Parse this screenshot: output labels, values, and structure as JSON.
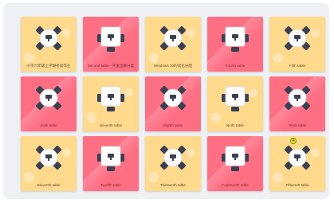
{
  "tables": [
    {
      "label": "小学六年级上学期考试作业",
      "color": "yellow",
      "style": "round"
    },
    {
      "label": "Second table - 开发出版分类",
      "color": "red",
      "style": "square"
    },
    {
      "label": "Windows 10的优化分配",
      "color": "yellow",
      "style": "round"
    },
    {
      "label": "Fourth table",
      "color": "red",
      "style": "square"
    },
    {
      "label": "Fifth table",
      "color": "yellow",
      "style": "round"
    },
    {
      "label": "Sixth table",
      "color": "red",
      "style": "round"
    },
    {
      "label": "Seventh table",
      "color": "yellow",
      "style": "square"
    },
    {
      "label": "Eighth table",
      "color": "red",
      "style": "round"
    },
    {
      "label": "Ninth table",
      "color": "yellow",
      "style": "square"
    },
    {
      "label": "Tenth table",
      "color": "red",
      "style": "round"
    },
    {
      "label": "Eleventh table",
      "color": "yellow",
      "style": "round"
    },
    {
      "label": "Twelfth table",
      "color": "red",
      "style": "square"
    },
    {
      "label": "Thirteenth table",
      "color": "yellow",
      "style": "round"
    },
    {
      "label": "Fourteenth table",
      "color": "red",
      "style": "square"
    },
    {
      "label": "Fifteenth table",
      "color": "yellow",
      "style": "round",
      "badge": "1"
    }
  ],
  "colors": {
    "yellow": "#ffd98c",
    "red": "#ff6f84",
    "chair": "#3b3f52",
    "tabletop": "#ffffff"
  }
}
